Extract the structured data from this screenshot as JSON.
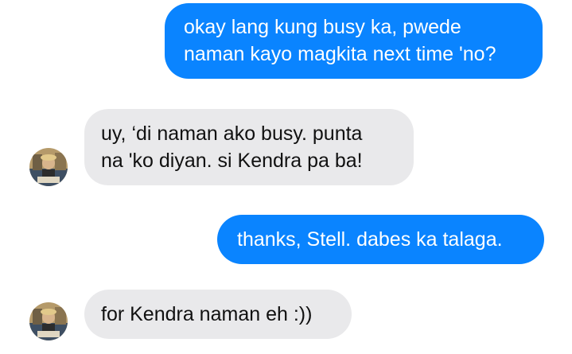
{
  "conversation": {
    "messages": [
      {
        "direction": "outgoing",
        "lines": [
          "okay lang kung busy ka, pwede",
          "naman kayo magkita next time 'no?"
        ]
      },
      {
        "direction": "incoming",
        "lines": [
          "uy, ‘di naman ako busy. punta",
          "na 'ko diyan. si Kendra pa ba!"
        ]
      },
      {
        "direction": "outgoing",
        "lines": [
          "thanks, Stell. dabes ka talaga."
        ]
      },
      {
        "direction": "incoming",
        "lines": [
          "for Kendra naman eh :))"
        ]
      }
    ]
  },
  "colors": {
    "outgoing_bubble": "#0a84ff",
    "incoming_bubble": "#e9e9eb",
    "background": "#ffffff"
  }
}
